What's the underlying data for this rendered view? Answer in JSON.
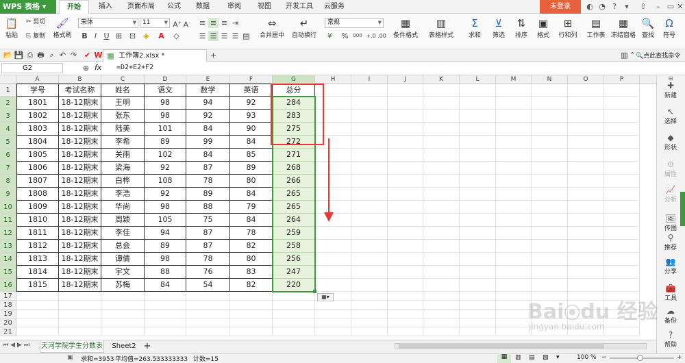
{
  "app": {
    "name": "WPS 表格"
  },
  "menu": {
    "tabs": [
      "开始",
      "插入",
      "页面布局",
      "公式",
      "数据",
      "审阅",
      "视图",
      "开发工具",
      "云服务"
    ],
    "login": "未登录"
  },
  "ribbon": {
    "paste": "粘贴",
    "cut": "剪切",
    "copy": "复制",
    "format_painter": "格式刷",
    "font_name": "宋体",
    "font_size": "11",
    "merge_center": "合并居中",
    "wrap_text": "自动换行",
    "number_format": "常规",
    "percent": "%",
    "thousands": "000",
    "conditional_format": "条件格式",
    "table_style": "表格样式",
    "sum": "求和",
    "filter": "筛选",
    "sort": "排序",
    "format": "格式",
    "row_col": "行和列",
    "worksheet": "工作表",
    "freeze": "冻结窗格",
    "find": "查找",
    "symbol": "符号"
  },
  "document": {
    "tab_title": "工作簿2.xlsx *",
    "search_label": "点此查找命令"
  },
  "formula_bar": {
    "cell_ref": "G2",
    "fx": "fx",
    "formula": "=D2+E2+F2"
  },
  "sheet": {
    "columns": [
      "A",
      "B",
      "C",
      "D",
      "E",
      "F",
      "G",
      "H",
      "I",
      "J",
      "K",
      "L",
      "M",
      "N",
      "O",
      "P"
    ],
    "row_numbers": [
      "1",
      "2",
      "3",
      "4",
      "5",
      "6",
      "7",
      "8",
      "9",
      "10",
      "11",
      "12",
      "13",
      "14",
      "15",
      "16",
      "17",
      "18",
      "19",
      "20",
      "21"
    ],
    "header": [
      "学号",
      "考试名称",
      "姓名",
      "语文",
      "数学",
      "英语",
      "总分"
    ],
    "rows": [
      [
        "1801",
        "18-12期末",
        "王明",
        "98",
        "94",
        "92",
        "284"
      ],
      [
        "1802",
        "18-12期末",
        "张东",
        "98",
        "92",
        "93",
        "283"
      ],
      [
        "1803",
        "18-12期末",
        "陆美",
        "101",
        "84",
        "90",
        "275"
      ],
      [
        "1804",
        "18-12期末",
        "李希",
        "89",
        "99",
        "84",
        "272"
      ],
      [
        "1805",
        "18-12期末",
        "关雨",
        "102",
        "84",
        "85",
        "271"
      ],
      [
        "1806",
        "18-12期末",
        "梁海",
        "92",
        "87",
        "89",
        "268"
      ],
      [
        "1807",
        "18-12期末",
        "白桦",
        "108",
        "78",
        "80",
        "266"
      ],
      [
        "1808",
        "18-12期末",
        "李浩",
        "92",
        "89",
        "84",
        "265"
      ],
      [
        "1809",
        "18-12期末",
        "华尚",
        "98",
        "88",
        "79",
        "265"
      ],
      [
        "1810",
        "18-12期末",
        "周颖",
        "105",
        "75",
        "84",
        "264"
      ],
      [
        "1811",
        "18-12期末",
        "李佳",
        "94",
        "87",
        "78",
        "259"
      ],
      [
        "1812",
        "18-12期末",
        "总会",
        "89",
        "87",
        "82",
        "258"
      ],
      [
        "1813",
        "18-12期末",
        "谭倩",
        "98",
        "78",
        "80",
        "256"
      ],
      [
        "1814",
        "18-12期末",
        "宇文",
        "88",
        "76",
        "83",
        "247"
      ],
      [
        "1815",
        "18-12期末",
        "苏梅",
        "84",
        "54",
        "82",
        "220"
      ]
    ]
  },
  "sidebar": {
    "items": [
      "新建",
      "选择",
      "形状",
      "属性",
      "分析",
      "传图",
      "推荐",
      "分享",
      "工具",
      "备份",
      "帮助"
    ]
  },
  "sheet_tabs": {
    "active": "天河学院学生分数表",
    "other": "Sheet2",
    "add": "+"
  },
  "status": {
    "sum": "求和=3953",
    "average": "平均值=263.533333333",
    "count": "计数=15",
    "zoom": "100 %"
  },
  "watermark": {
    "text": "Bai du 经验",
    "url": "jingyan.baidu.com"
  },
  "colors": {
    "accent": "#3c9a3c",
    "annotation": "#e53935",
    "selection_fill": "#e7f3dd"
  }
}
